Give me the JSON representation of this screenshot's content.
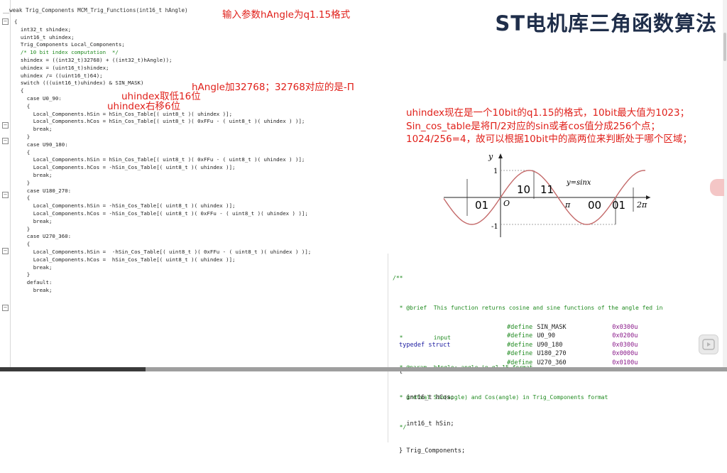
{
  "title": "ST电机库三角函数算法",
  "function_signature": "__weak Trig_Components MCM_Trig_Functions(int16_t hAngle)",
  "code_lines": [
    "{",
    "",
    "  int32_t shindex;",
    "  uint16_t uhindex;",
    "",
    "  Trig_Components Local_Components;",
    "",
    "  /* 10 bit index computation  */",
    "  shindex = ((int32_t)32768) + ((int32_t)hAngle));",
    "  uhindex = (uint16_t)shindex;",
    "  uhindex /= ((uint16_t)64);",
    "",
    "  switch (((uint16_t)uhindex) & SIN_MASK)",
    "  {",
    "    case U0_90:",
    "    {",
    "      Local_Components.hSin = hSin_Cos_Table[( uint8_t )( uhindex )];",
    "      Local_Components.hCos = hSin_Cos_Table[( uint8_t )( 0xFFu - ( uint8_t )( uhindex ) )];",
    "      break;",
    "    }",
    "",
    "",
    "    case U90_180:",
    "    {",
    "      Local_Components.hSin = hSin_Cos_Table[( uint8_t )( 0xFFu - ( uint8_t )( uhindex ) )];",
    "      Local_Components.hCos = -hSin_Cos_Table[( uint8_t )( uhindex )];",
    "      break;",
    "    }",
    "",
    "",
    "    case U180_270:",
    "    {",
    "      Local_Components.hSin = -hSin_Cos_Table[( uint8_t )( uhindex )];",
    "      Local_Components.hCos = -hSin_Cos_Table[( uint8_t )( 0xFFu - ( uint8_t )( uhindex ) )];",
    "      break;",
    "    }",
    "",
    "",
    "    case U270_360:",
    "    {",
    "      Local_Components.hSin =  -hSin_Cos_Table[( uint8_t )( 0xFFu - ( uint8_t )( uhindex ) )];",
    "      Local_Components.hCos =  hSin_Cos_Table[( uint8_t )( uhindex )];",
    "      break;",
    "    }",
    "",
    "    default:",
    "      break;"
  ],
  "annotations": {
    "input": "输入参数hAngle为q1.15格式",
    "add": "hAngle加32768；32768对应的是-Π",
    "low16": "uhindex取低16位",
    "shift": "uhindex右移6位"
  },
  "notes": [
    "uhindex现在是一个10bit的q1.15的格式，10bit最大值为1023；",
    "Sin_cos_table是将Π/2对应的sin或者cos值分成256个点；",
    "1024/256=4，故可以根据10bit中的高两位来判断处于哪个区域；"
  ],
  "graph": {
    "y_label": "y",
    "y_max": "1",
    "y_min": "-1",
    "origin": "O",
    "pi": "π",
    "two_pi": "2π",
    "curve_label": "y=sinx",
    "region_labels": [
      "01",
      "10",
      "11",
      "00",
      "01"
    ]
  },
  "doc_comment": [
    "/**",
    "  * @brief  This function returns cosine and sine functions of the angle fed in",
    "  *         input",
    "  * @param  hAngle: angle in q1.15 format",
    "  * @retval Sin(angle) and Cos(angle) in Trig_Components format",
    "  */"
  ],
  "struct_lines": [
    "typedef struct",
    "{",
    "  int16_t hCos;",
    "  int16_t hSin;",
    "} Trig_Components;"
  ],
  "defines": [
    {
      "name": "SIN_MASK",
      "value": "0x0300u"
    },
    {
      "name": "U0_90",
      "value": "0x0200u"
    },
    {
      "name": "U90_180",
      "value": "0x0300u"
    },
    {
      "name": "U180_270",
      "value": "0x0000u"
    },
    {
      "name": "U270_360",
      "value": "0x0100u"
    }
  ],
  "define_keyword": "#define",
  "colors": {
    "annotation": "#e0201a",
    "title": "#1f2e4a",
    "comment": "#1f8a1f",
    "keyword": "#1a1aa0"
  }
}
